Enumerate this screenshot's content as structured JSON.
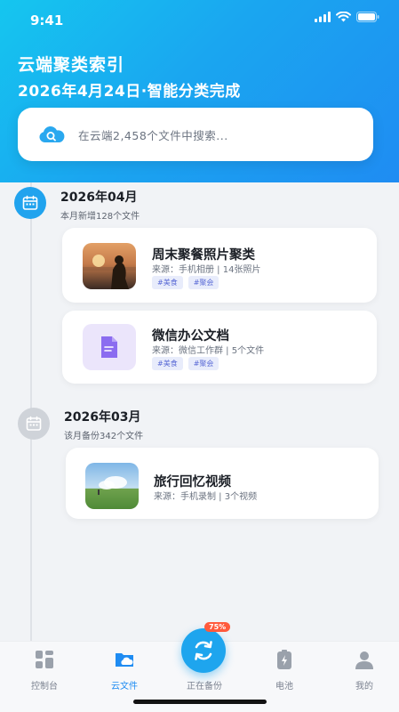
{
  "status": {
    "time": "9:41"
  },
  "header": {
    "title": "云端聚类索引",
    "subtitle": "2026年4月24日·智能分类完成"
  },
  "search": {
    "placeholder": "在云端2,458个文件中搜索..."
  },
  "months": [
    {
      "title": "2026年04月",
      "subtitle": "本月新增128个文件",
      "icon": "calendar-icon",
      "accent": "#21a3ee",
      "cards": [
        {
          "title": "周末聚餐照片聚类",
          "meta": "来源：手机相册 | 14张照片",
          "tags": [
            "#美食",
            "#聚会"
          ],
          "thumb": "sunset-photo"
        },
        {
          "title": "微信办公文档",
          "meta": "来源：微信工作群 | 5个文件",
          "tags": [
            "#美食",
            "#聚会"
          ],
          "thumb": "document-icon"
        }
      ]
    },
    {
      "title": "2026年03月",
      "subtitle": "该月备份342个文件",
      "icon": "calendar-icon",
      "accent": "#cfd3d9",
      "cards": [
        {
          "title": "旅行回忆视频",
          "meta": "来源：手机录制 | 3个视频",
          "thumb": "landscape-photo"
        }
      ]
    }
  ],
  "tabbar": {
    "items": [
      {
        "label": "控制台",
        "icon": "dashboard-icon"
      },
      {
        "label": "云文件",
        "icon": "cloud-folder-icon"
      },
      {
        "label": "正在备份",
        "icon": "sync-icon"
      },
      {
        "label": "电池",
        "icon": "battery-icon"
      },
      {
        "label": "我的",
        "icon": "user-icon"
      }
    ],
    "active_index": 1,
    "backup_progress": "75%"
  },
  "colors": {
    "brand": "#1f8cf2",
    "header_start": "#15c6ef",
    "tag_text": "#5b6bd6"
  }
}
